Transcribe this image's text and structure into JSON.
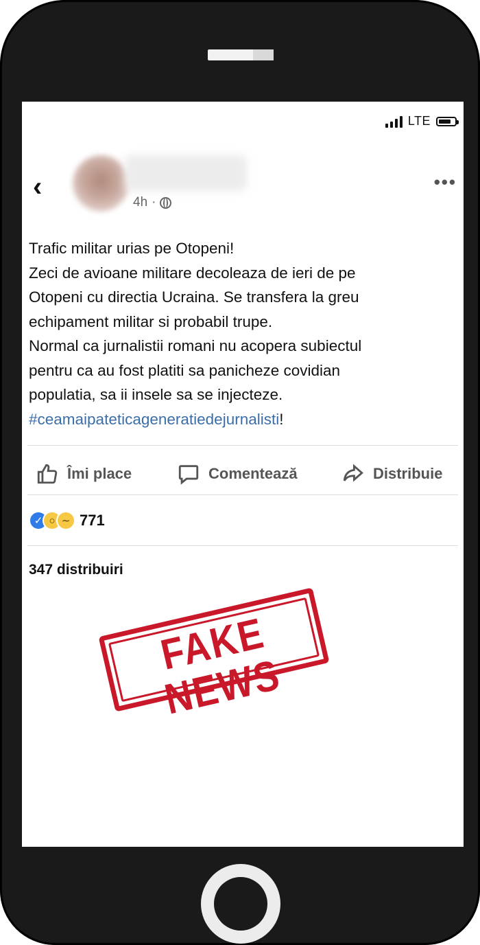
{
  "status_bar": {
    "network": "LTE",
    "signal_bars": 4,
    "battery_level_percent": 75
  },
  "post": {
    "time": "4h",
    "separator": "·",
    "lines": [
      "Trafic militar urias pe Otopeni!",
      "Zeci de avioane militare decoleaza de ieri de pe",
      "Otopeni cu directia Ucraina. Se transfera la greu",
      "echipament militar si probabil trupe.",
      "Normal ca jurnalistii romani nu acopera subiectul",
      "pentru ca au fost platiti sa panicheze covidian",
      "populatia, sa ii insele sa se injecteze."
    ],
    "hashtag": "#ceamaipateticageneratiedejurnalisti",
    "hashtag_suffix": "!"
  },
  "actions": {
    "like_label": "Îmi place",
    "comment_label": "Comentează",
    "share_label": "Distribuie"
  },
  "reactions": {
    "types": [
      "like",
      "wow",
      "sad"
    ],
    "count": "771"
  },
  "shares": "347 distribuiri",
  "stamp": {
    "text": "FAKE NEWS",
    "color": "#c9182a"
  },
  "colors": {
    "hashtag": "#3b6ea8",
    "like_blue": "#2f7be8"
  }
}
